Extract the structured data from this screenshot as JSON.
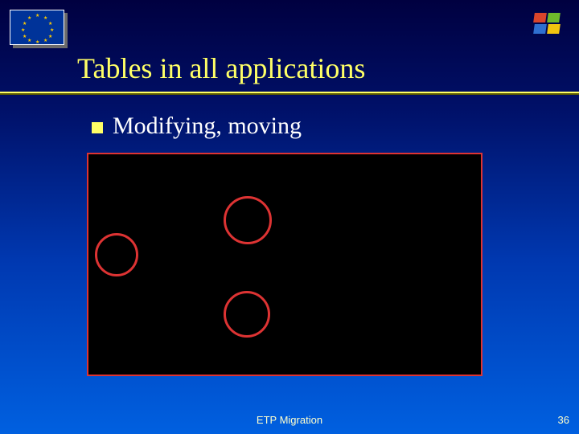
{
  "header": {
    "eu_flag_name": "eu-flag-icon",
    "windows_logo_name": "windows-logo-icon"
  },
  "title": "Tables in all applications",
  "bullet": {
    "text": "Modifying, moving"
  },
  "content": {
    "rings": 3
  },
  "footer": {
    "label": "ETP Migration",
    "page": "36"
  }
}
